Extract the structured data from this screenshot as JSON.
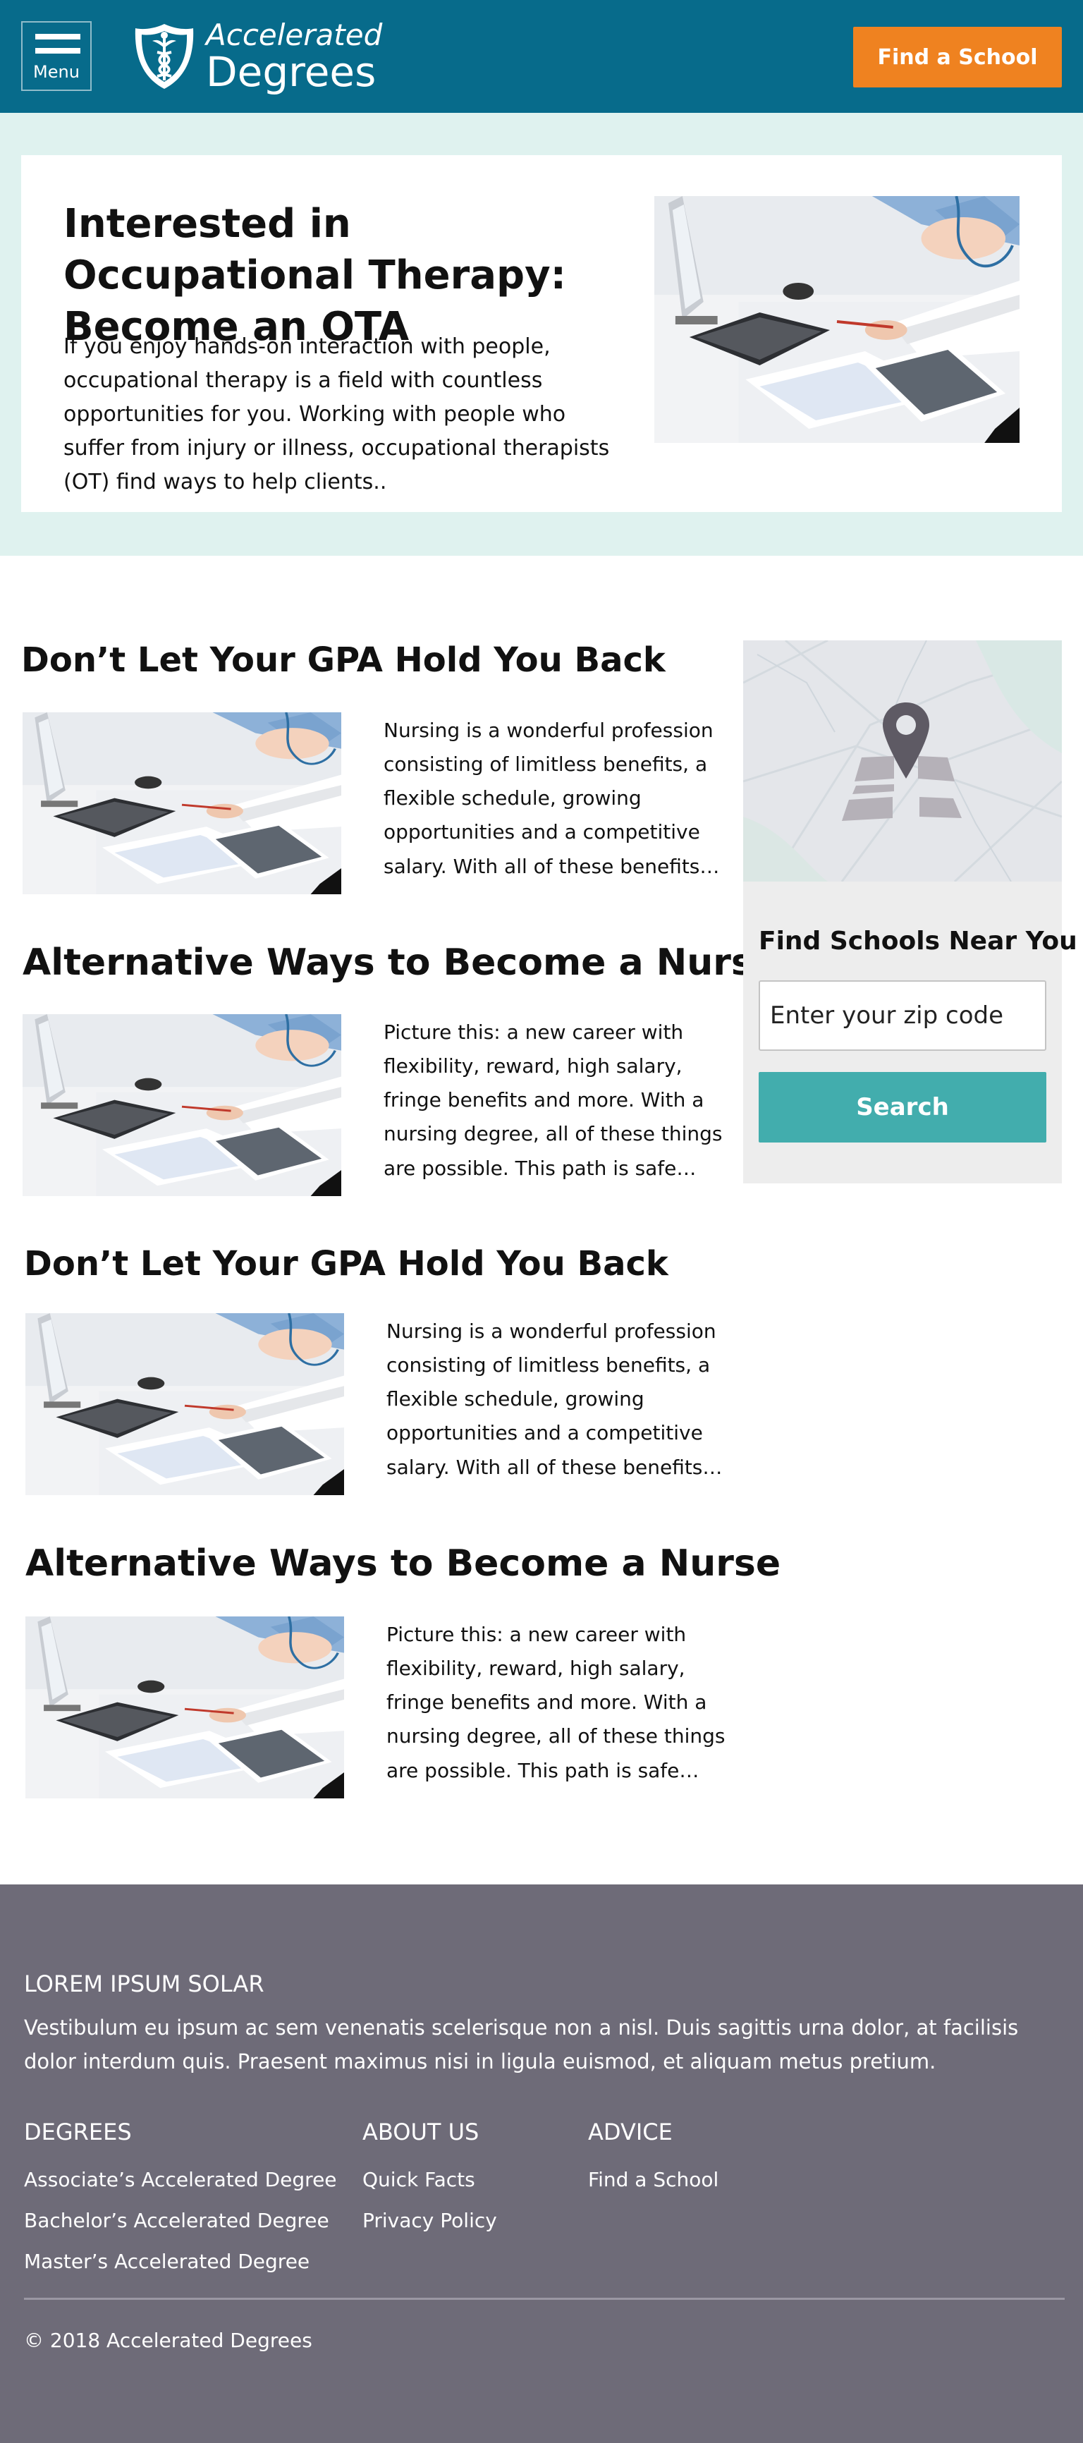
{
  "header": {
    "menu_label": "Menu",
    "logo_line1": "Accelerated",
    "logo_line2": "Degrees",
    "cta_label": "Find a School",
    "bg_color": "#076b8b",
    "cta_color": "#ef8220"
  },
  "hero": {
    "title": "Interested in Occupational Therapy: Become an OTA",
    "text": "If you enjoy hands-on interaction with people, occupational therapy is a field with countless opportunities for you. Working with people who suffer from injury or illness, occupational therapists (OT) find ways to help clients..",
    "image_icon": "medical-desk-photo"
  },
  "articles": [
    {
      "title": "Don’t Let Your GPA Hold You Back",
      "excerpt": "Nursing is a wonderful profession consisting of limitless benefits, a flexible schedule, growing opportunities and a competitive salary. With all of these benefits…"
    },
    {
      "title": "Alternative Ways to Become a Nurse",
      "excerpt": "Picture this: a new career with flexibility, reward, high salary, fringe benefits and more. With a nursing degree, all of these things are possible. This path is safe…"
    },
    {
      "title": "Don’t Let Your GPA Hold You Back",
      "excerpt": "Nursing is a wonderful profession consisting of limitless benefits, a flexible schedule, growing opportunities and a competitive salary. With all of these benefits…"
    },
    {
      "title": "Alternative Ways to Become a Nurse",
      "excerpt": "Picture this: a new career with flexibility, reward, high salary, fringe benefits and more. With a nursing degree, all of these things are possible. This path is safe…"
    }
  ],
  "sidebar": {
    "title": "Find Schools Near You",
    "zip_placeholder": "Enter your zip code",
    "search_label": "Search",
    "map_icon": "map-pin-icon",
    "button_color": "#42adad"
  },
  "footer": {
    "heading": "LOREM IPSUM SOLAR",
    "paragraph": "Vestibulum eu ipsum ac sem venenatis scelerisque non a nisl. Duis sagittis urna dolor, at facilisis dolor interdum quis. Praesent maximus nisi in ligula euismod, et aliquam metus pretium.",
    "columns": [
      {
        "title": "DEGREES",
        "links": [
          "Associate’s Accelerated Degree",
          "Bachelor’s Accelerated Degree",
          "Master’s Accelerated Degree"
        ]
      },
      {
        "title": "ABOUT US",
        "links": [
          "Quick Facts",
          "Privacy Policy"
        ]
      },
      {
        "title": "ADVICE",
        "links": [
          "Find a School"
        ]
      }
    ],
    "copyright": "© 2018 Accelerated Degrees",
    "bg_color": "#6e6b78"
  }
}
